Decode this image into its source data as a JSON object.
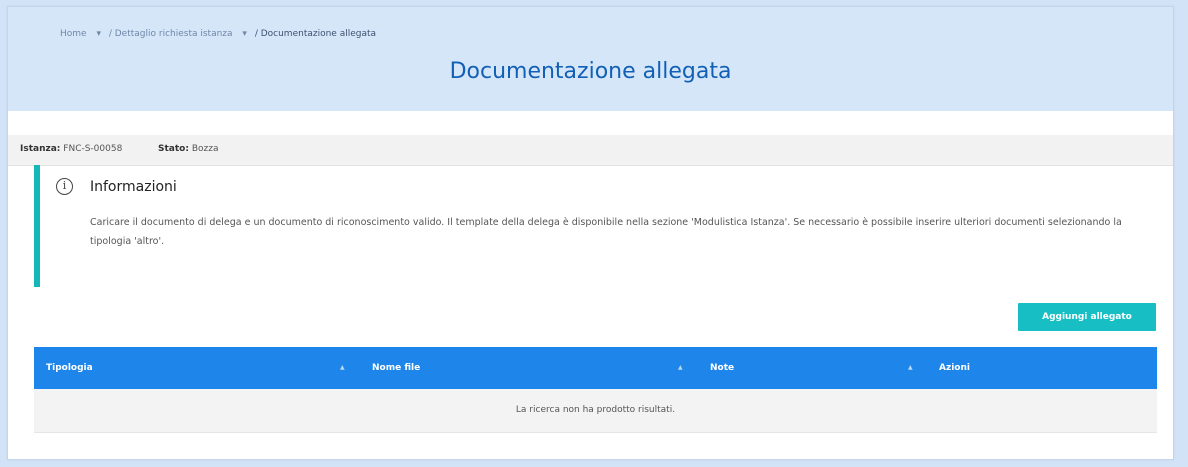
{
  "breadcrumb": {
    "items": [
      "Home",
      "/ Dettaglio richiesta istanza",
      "/ Documentazione allegata"
    ]
  },
  "page_title": "Documentazione allegata",
  "status": {
    "istanza_label": "Istanza:",
    "istanza_value": "FNC-S-00058",
    "stato_label": "Stato:",
    "stato_value": "Bozza"
  },
  "info": {
    "icon": "info-circle-icon",
    "title": "Informazioni",
    "text": "Caricare il documento di delega e un documento di riconoscimento valido. Il template della delega è disponibile nella sezione 'Modulistica Istanza'. Se necessario è possibile inserire ulteriori documenti selezionando la tipologia 'altro'."
  },
  "add_button_label": "Aggiungi allegato",
  "table": {
    "columns": [
      "Tipologia",
      "Nome file",
      "Note",
      "Azioni"
    ],
    "empty_message": "La ricerca non ha prodotto risultati."
  },
  "colors": {
    "title": "#1160b5",
    "accent": "#14b8b8",
    "table_header": "#1e86ea"
  }
}
